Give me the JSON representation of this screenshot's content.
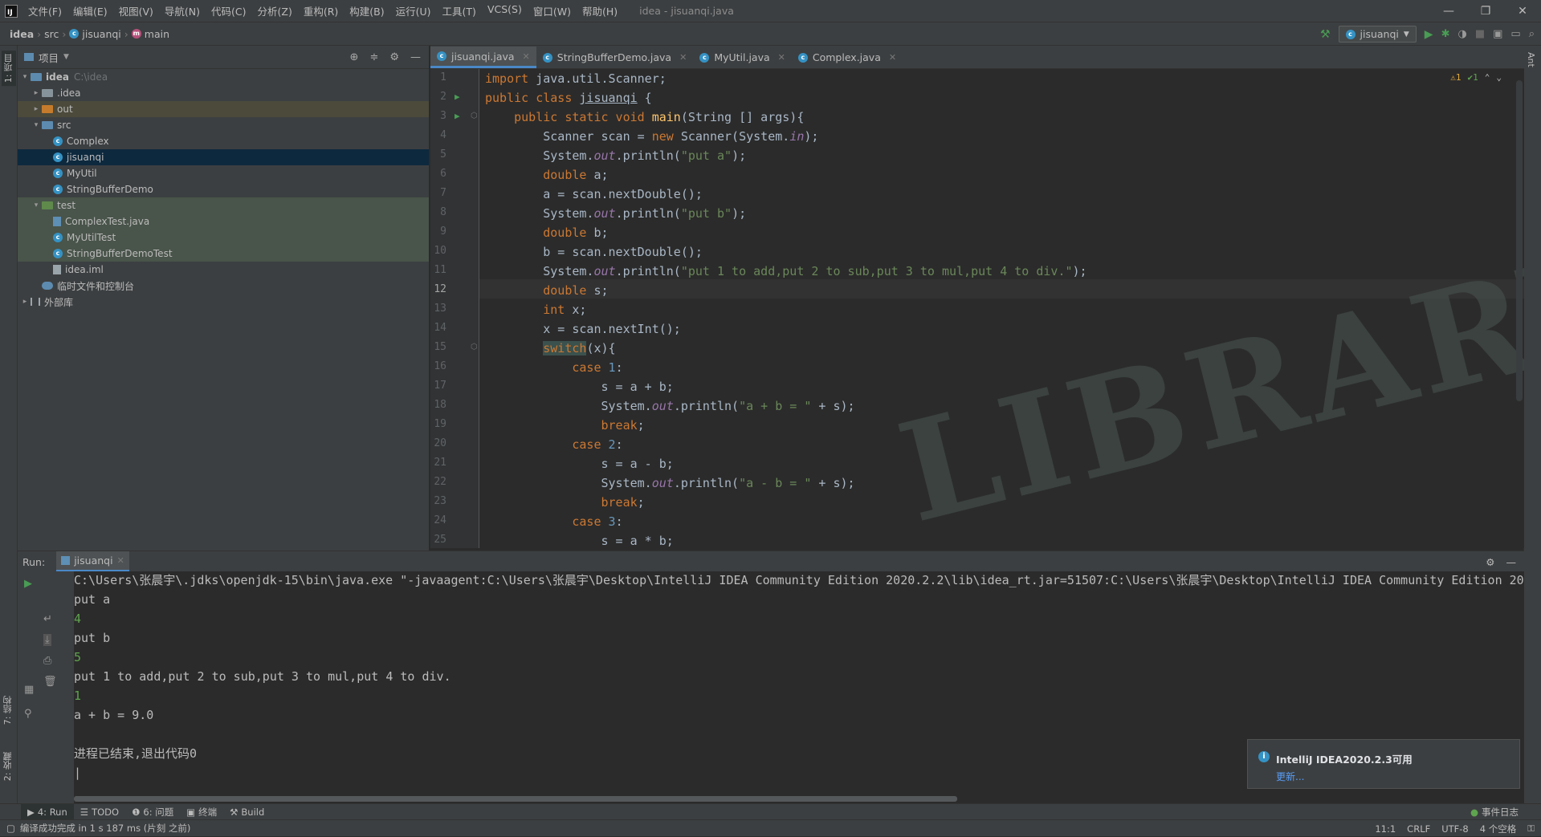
{
  "menubar": {
    "items": [
      "文件(F)",
      "编辑(E)",
      "视图(V)",
      "导航(N)",
      "代码(C)",
      "分析(Z)",
      "重构(R)",
      "构建(B)",
      "运行(U)",
      "工具(T)",
      "VCS(S)",
      "窗口(W)",
      "帮助(H)"
    ],
    "title": "idea - jisuanqi.java",
    "minimize": "—",
    "restore": "❐",
    "close": "✕"
  },
  "navbar": {
    "crumbs": [
      "idea",
      "src",
      "jisuanqi",
      "main"
    ],
    "run_config": "jisuanqi"
  },
  "left_strip": {
    "project_tab": "1: 项目",
    "structure_tab": "7: 结构",
    "favorites_tab": "2: 收藏"
  },
  "right_strip": {
    "ant_tab": "Ant"
  },
  "project": {
    "header": "项目",
    "tree": [
      {
        "label": "idea",
        "extra": "C:\\idea"
      },
      {
        "label": ".idea"
      },
      {
        "label": "out"
      },
      {
        "label": "src"
      },
      {
        "label": "Complex"
      },
      {
        "label": "jisuanqi"
      },
      {
        "label": "MyUtil"
      },
      {
        "label": "StringBufferDemo"
      },
      {
        "label": "test"
      },
      {
        "label": "ComplexTest.java"
      },
      {
        "label": "MyUtilTest"
      },
      {
        "label": "StringBufferDemoTest"
      },
      {
        "label": "idea.iml"
      },
      {
        "label": "临时文件和控制台"
      },
      {
        "label": "外部库"
      }
    ]
  },
  "editor": {
    "tabs": [
      "jisuanqi.java",
      "StringBufferDemo.java",
      "MyUtil.java",
      "Complex.java"
    ],
    "warnings": "⚠1",
    "checks": "✔1",
    "line_numbers": [
      "1",
      "2",
      "3",
      "4",
      "5",
      "6",
      "7",
      "8",
      "9",
      "10",
      "11",
      "12",
      "13",
      "14",
      "15",
      "16",
      "17",
      "18",
      "19",
      "20",
      "21",
      "22",
      "23",
      "24",
      "25"
    ],
    "current_line": 12,
    "watermark": "LIBRARY OF RUINA"
  },
  "run": {
    "label": "Run:",
    "tab": "jisuanqi",
    "console": [
      "C:\\Users\\张晨宇\\.jdks\\openjdk-15\\bin\\java.exe \"-javaagent:C:\\Users\\张晨宇\\Desktop\\IntelliJ IDEA Community Edition 2020.2.2\\lib\\idea_rt.jar=51507:C:\\Users\\张晨宇\\Desktop\\IntelliJ IDEA Community Edition 202",
      "put a",
      "4",
      "put b",
      "5",
      "put 1 to add,put 2 to sub,put 3 to mul,put 4 to div.",
      "1",
      "a + b = 9.0",
      "",
      "进程已结束,退出代码0"
    ]
  },
  "notification": {
    "title": "IntelliJ IDEA2020.2.3可用",
    "link": "更新..."
  },
  "toolwindows": {
    "run": "4: Run",
    "todo": "TODO",
    "problems": "6: 问题",
    "terminal": "终端",
    "build": "Build",
    "eventlog": "事件日志"
  },
  "status": {
    "message": "编译成功完成 in 1 s 187 ms (片刻 之前)",
    "position": "11:1",
    "line_sep": "CRLF",
    "encoding": "UTF-8",
    "indent": "4 个空格"
  },
  "colors": {
    "accent": "#4a88c7",
    "keyword": "#cc7832",
    "string": "#6a8759",
    "number": "#6897bb"
  }
}
